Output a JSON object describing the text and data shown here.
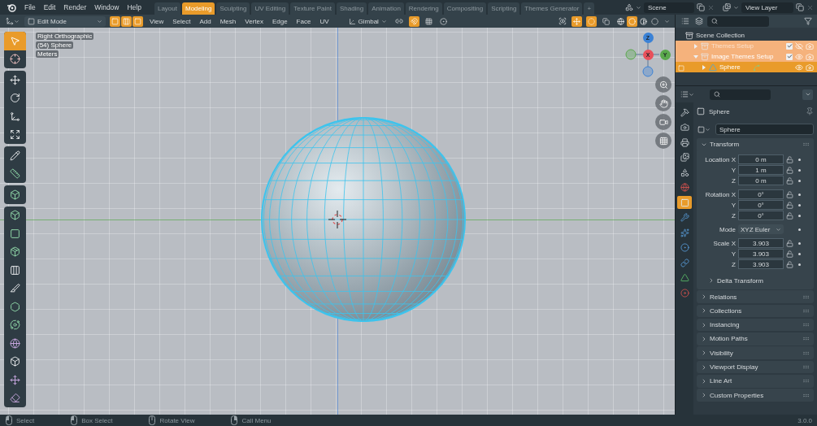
{
  "menu": [
    "File",
    "Edit",
    "Render",
    "Window",
    "Help"
  ],
  "workspaces": [
    {
      "label": "Layout",
      "selected": false
    },
    {
      "label": "Modeling",
      "selected": true
    },
    {
      "label": "Sculpting",
      "selected": false
    },
    {
      "label": "UV Editing",
      "selected": false
    },
    {
      "label": "Texture Paint",
      "selected": false
    },
    {
      "label": "Shading",
      "selected": false
    },
    {
      "label": "Animation",
      "selected": false
    },
    {
      "label": "Rendering",
      "selected": false
    },
    {
      "label": "Compositing",
      "selected": false
    },
    {
      "label": "Scripting",
      "selected": false
    },
    {
      "label": "Themes Generator",
      "selected": false
    }
  ],
  "add_workspace": "+",
  "scene": {
    "value": "Scene"
  },
  "view_layer": {
    "value": "View Layer"
  },
  "viewport_header": {
    "mode": "Edit Mode",
    "select_modes": [
      {
        "kind": "vertex",
        "selected": true
      },
      {
        "kind": "edge",
        "selected": true
      },
      {
        "kind": "face",
        "selected": true
      }
    ],
    "menus": [
      "View",
      "Select",
      "Add",
      "Mesh",
      "Vertex",
      "Edge",
      "Face",
      "UV"
    ],
    "orientation": "Gimbal",
    "snap": {
      "on": true
    },
    "proportional": {
      "on": false
    },
    "gizmos": {
      "on": true
    },
    "overlays": {
      "on": true
    },
    "xray": {
      "on": false
    },
    "shading": [
      {
        "kind": "wireframe",
        "selected": false
      },
      {
        "kind": "solid",
        "selected": true
      },
      {
        "kind": "material",
        "selected": false
      },
      {
        "kind": "rendered",
        "selected": false
      }
    ]
  },
  "toolbar": [
    {
      "tools": [
        {
          "kind": "select",
          "selected": true
        },
        {
          "kind": "cursor",
          "selected": false
        }
      ]
    },
    {
      "tools": [
        {
          "kind": "move",
          "selected": false
        },
        {
          "kind": "rotate",
          "selected": false
        },
        {
          "kind": "scale",
          "selected": false
        },
        {
          "kind": "transform",
          "selected": false
        }
      ]
    },
    {
      "tools": [
        {
          "kind": "annotate",
          "selected": false
        },
        {
          "kind": "measure",
          "selected": false
        }
      ]
    },
    {
      "tools": [
        {
          "kind": "add-cube",
          "selected": false
        }
      ]
    },
    {
      "tools": [
        {
          "kind": "extrude",
          "selected": false
        },
        {
          "kind": "inset",
          "selected": false
        },
        {
          "kind": "bevel",
          "selected": false
        },
        {
          "kind": "loop-cut",
          "selected": false
        },
        {
          "kind": "knife",
          "selected": false
        },
        {
          "kind": "poly-build",
          "selected": false
        },
        {
          "kind": "spin",
          "selected": false
        },
        {
          "kind": "smooth",
          "selected": false
        },
        {
          "kind": "edge-slide",
          "selected": false
        },
        {
          "kind": "shrink",
          "selected": false
        },
        {
          "kind": "shear",
          "selected": false
        }
      ]
    }
  ],
  "viewport_info": [
    "Right Orthographic",
    "(54) Sphere",
    "Meters"
  ],
  "gizmo_axes": [
    {
      "label": "Z",
      "color": "#3b82d6"
    },
    {
      "label": "X",
      "color": "#e8505b"
    },
    {
      "label": "Y",
      "color": "#5aa84c"
    }
  ],
  "outliner": {
    "root": {
      "label": "Scene Collection",
      "children": [
        {
          "label": "Themes Setup",
          "kind": "collection",
          "expanded": false,
          "selected": true,
          "active": false,
          "checked": true,
          "visible": false
        },
        {
          "label": "Image Themes Setup",
          "kind": "collection",
          "expanded": true,
          "selected": true,
          "active": false,
          "checked": true,
          "visible": true,
          "children": [
            {
              "label": "Sphere",
              "kind": "mesh",
              "expanded": false,
              "selected": true,
              "active": true,
              "visible": true
            }
          ]
        }
      ]
    }
  },
  "properties": {
    "tabs": [
      {
        "kind": "tool",
        "selected": false
      },
      {
        "kind": "render",
        "selected": false
      },
      {
        "kind": "output",
        "selected": false
      },
      {
        "kind": "view-layer",
        "selected": false
      },
      {
        "kind": "scene",
        "selected": false
      },
      {
        "kind": "world",
        "selected": false
      },
      {
        "kind": "object",
        "selected": true
      },
      {
        "kind": "modifiers",
        "selected": false
      },
      {
        "kind": "particles",
        "selected": false
      },
      {
        "kind": "physics",
        "selected": false
      },
      {
        "kind": "constraints",
        "selected": false
      },
      {
        "kind": "data",
        "selected": false
      },
      {
        "kind": "material",
        "selected": false
      }
    ],
    "object_name": "Sphere",
    "data_name": "Sphere",
    "transform": {
      "label": "Transform",
      "expanded": true,
      "sections": [
        {
          "kind": "fields",
          "rows": [
            {
              "label": "Location X",
              "value": "0 m"
            },
            {
              "label": "Y",
              "value": "1 m"
            },
            {
              "label": "Z",
              "value": "0 m"
            }
          ]
        },
        {
          "kind": "fields",
          "rows": [
            {
              "label": "Rotation X",
              "value": "0°"
            },
            {
              "label": "Y",
              "value": "0°"
            },
            {
              "label": "Z",
              "value": "0°"
            }
          ]
        },
        {
          "kind": "dropdown",
          "label": "Mode",
          "value": "XYZ Euler"
        },
        {
          "kind": "fields",
          "rows": [
            {
              "label": "Scale X",
              "value": "3.903"
            },
            {
              "label": "Y",
              "value": "3.903"
            },
            {
              "label": "Z",
              "value": "3.903"
            }
          ]
        }
      ],
      "subpanel": {
        "label": "Delta Transform",
        "expanded": false
      }
    },
    "panels": [
      {
        "label": "Relations",
        "expanded": false
      },
      {
        "label": "Collections",
        "expanded": false
      },
      {
        "label": "Instancing",
        "expanded": false
      },
      {
        "label": "Motion Paths",
        "expanded": false
      },
      {
        "label": "Visibility",
        "expanded": false
      },
      {
        "label": "Viewport Display",
        "expanded": false
      },
      {
        "label": "Line Art",
        "expanded": false
      },
      {
        "label": "Custom Properties",
        "expanded": false
      }
    ]
  },
  "status_bar": {
    "hints": [
      {
        "kind": "left-click",
        "label": "Select"
      },
      {
        "kind": "left-drag",
        "label": "Box Select"
      },
      {
        "kind": "middle-drag",
        "label": "Rotate View"
      },
      {
        "kind": "right-click",
        "label": "Call Menu"
      }
    ],
    "version": "3.0.0"
  }
}
